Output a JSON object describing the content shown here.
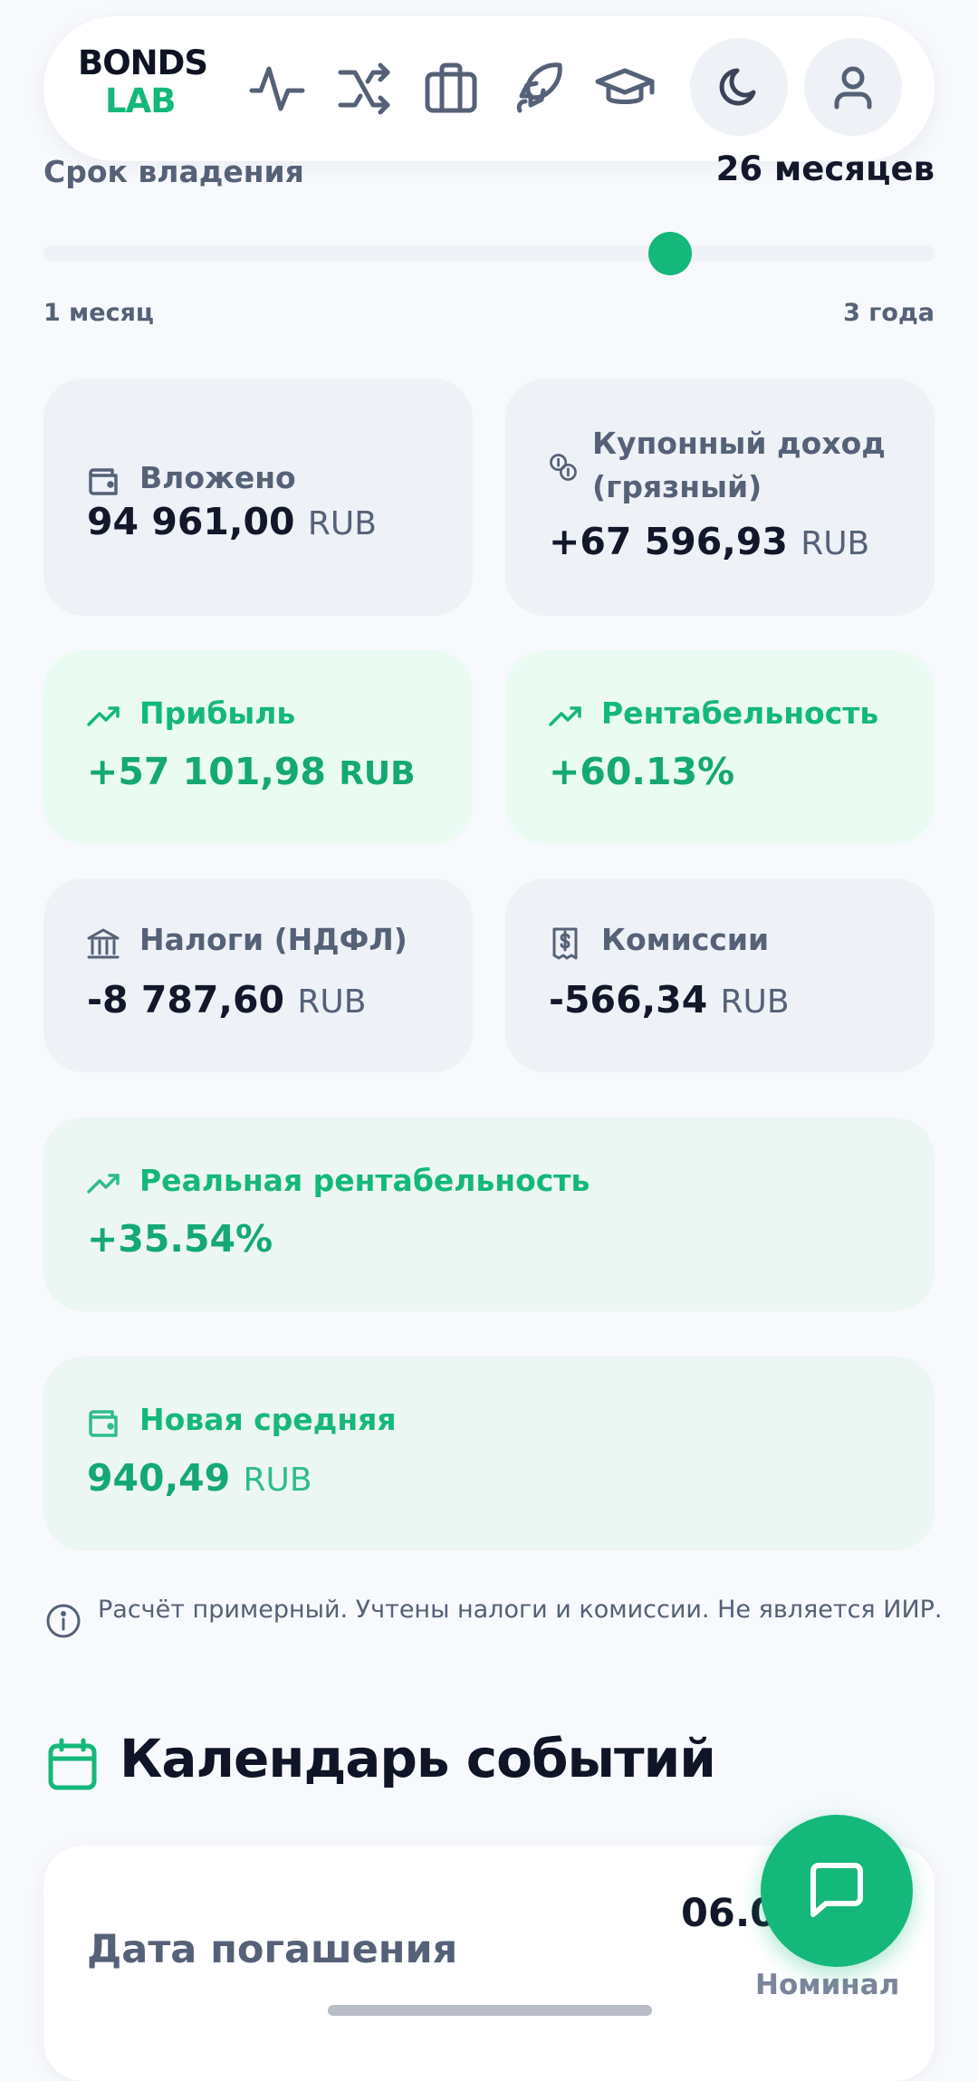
{
  "brand": {
    "line1": "BONDS",
    "line2": "LAB",
    "primary_color": "#14b87a"
  },
  "nav": {
    "icons": [
      "activity-icon",
      "shuffle-icon",
      "briefcase-icon",
      "rocket-icon",
      "graduation-cap-icon"
    ],
    "theme_toggle_icon": "moon-icon",
    "profile_icon": "user-icon"
  },
  "holding": {
    "label": "Срок владения",
    "value": "26 месяцев",
    "min_label": "1 месяц",
    "max_label": "3 года",
    "slider_fraction": 0.703
  },
  "cards": {
    "invested": {
      "label": "Вложено",
      "amount": "94 961,00",
      "currency": "RUB",
      "icon": "wallet-icon"
    },
    "coupon": {
      "label_line1": "Купонный доход",
      "label_line2": "(грязный)",
      "amount": "+67 596,93",
      "currency": "RUB",
      "icon": "coins-icon"
    },
    "profit": {
      "label": "Прибыль",
      "amount": "+57 101,98",
      "currency": "RUB",
      "icon": "trending-up-icon"
    },
    "yield": {
      "label": "Рентабельность",
      "amount": "+60.13%",
      "icon": "trending-up-icon"
    },
    "taxes": {
      "label": "Налоги (НДФЛ)",
      "amount": "-8 787,60",
      "currency": "RUB",
      "icon": "bank-icon"
    },
    "fees": {
      "label": "Комиссии",
      "amount": "-566,34",
      "currency": "RUB",
      "icon": "receipt-icon"
    },
    "real_yield": {
      "label": "Реальная рентабельность",
      "amount": "+35.54%",
      "icon": "trending-up-icon"
    },
    "new_avg": {
      "label": "Новая средняя",
      "amount": "940,49",
      "currency": "RUB",
      "icon": "wallet-icon"
    }
  },
  "disclaimer": "Расчёт примерный. Учтены налоги и комиссии. Не является ИИР.",
  "calendar": {
    "title": "Календарь событий",
    "event_label": "Дата погашения",
    "event_date": "06.0",
    "event_sub": "Номинал"
  },
  "fab_icon": "chat-icon"
}
